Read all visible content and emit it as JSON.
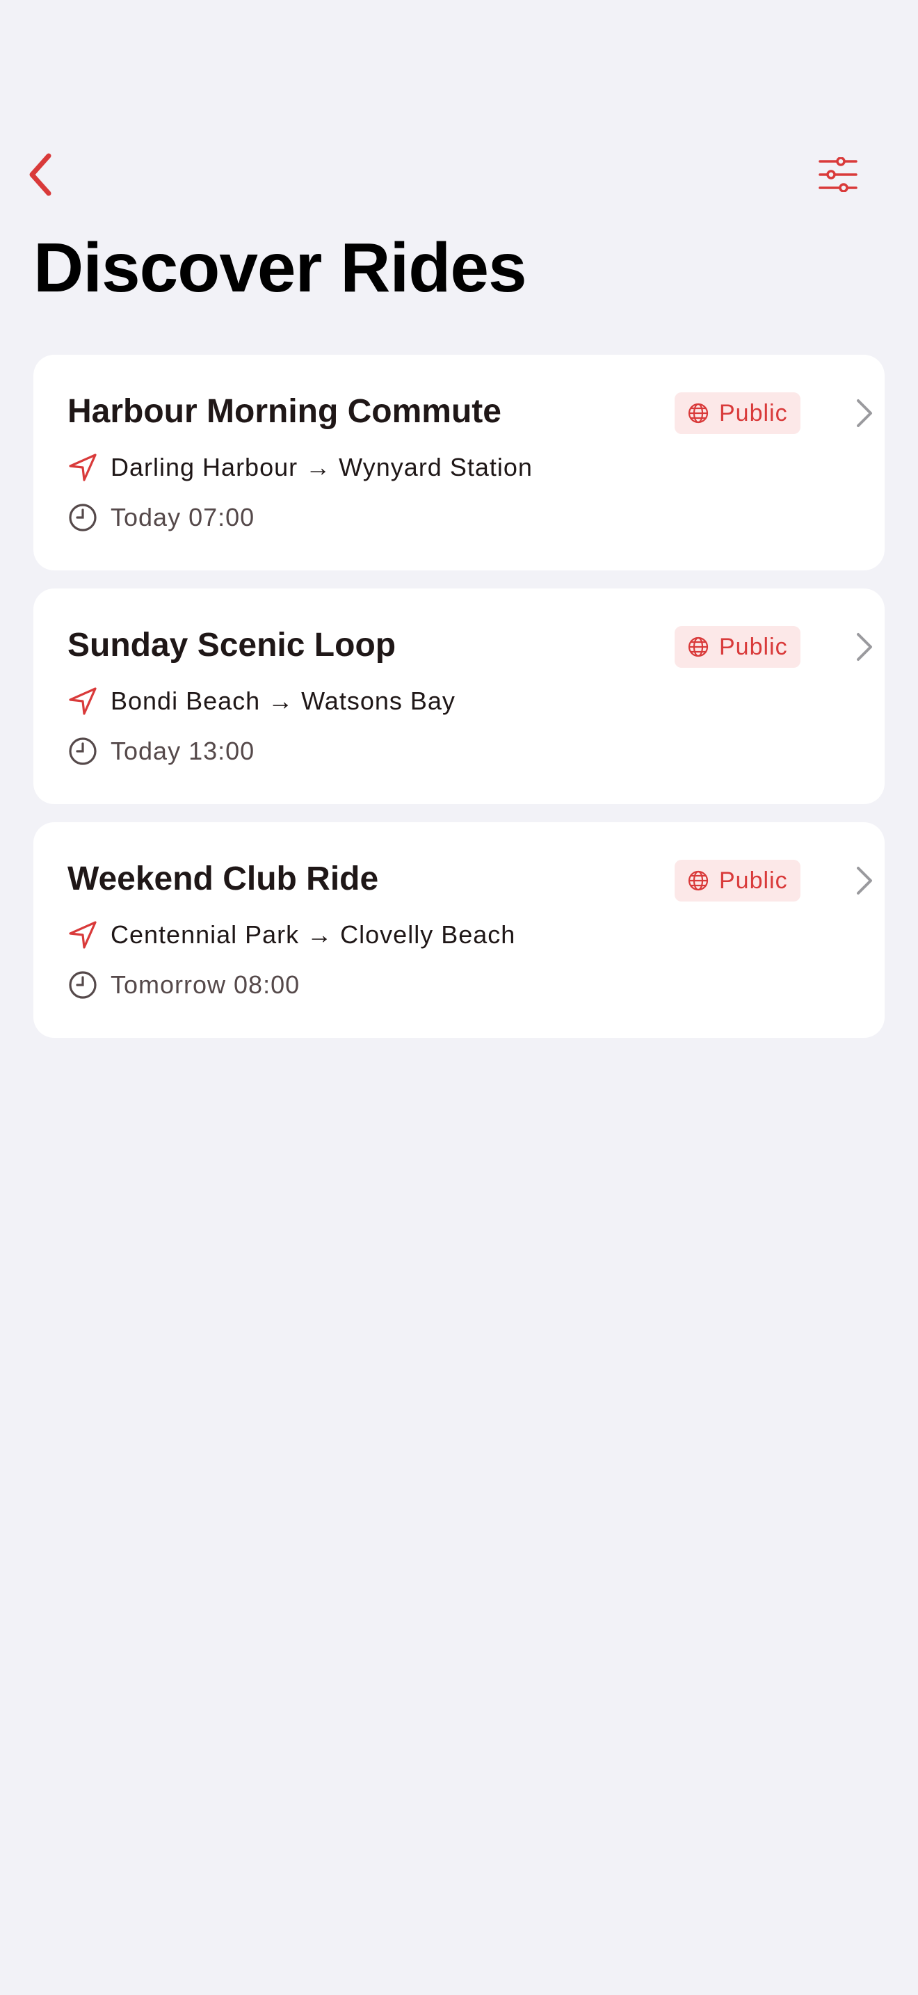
{
  "header": {
    "title": "Discover Rides",
    "back_icon": "chevron-left-icon",
    "filter_icon": "sliders-icon"
  },
  "colors": {
    "accent": "#D93A3A",
    "badge_bg": "#FCE8E8",
    "background": "#F2F2F7",
    "card": "#FFFFFF"
  },
  "rides": [
    {
      "title": "Harbour Morning Commute",
      "badge": "Public",
      "route": "Darling Harbour → Wynyard Station",
      "time": "Today 07:00"
    },
    {
      "title": "Sunday Scenic Loop",
      "badge": "Public",
      "route": "Bondi Beach → Watsons Bay",
      "time": "Today 13:00"
    },
    {
      "title": "Weekend Club Ride",
      "badge": "Public",
      "route": "Centennial Park → Clovelly Beach",
      "time": "Tomorrow 08:00"
    }
  ]
}
